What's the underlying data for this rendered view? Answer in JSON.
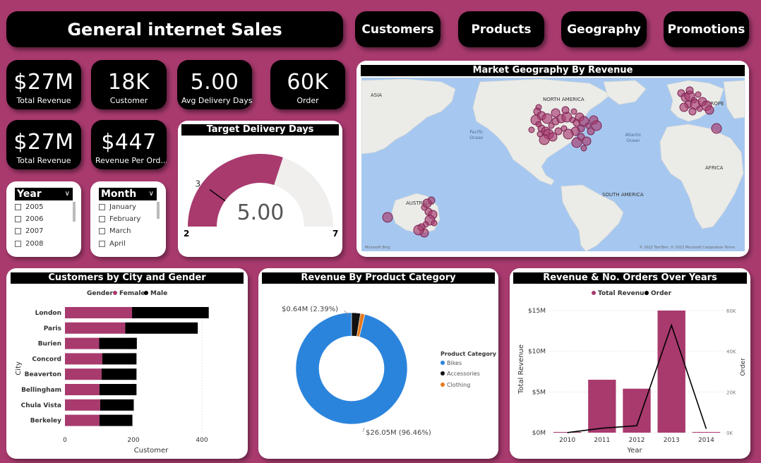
{
  "header": {
    "title": "General internet Sales",
    "nav": [
      "Customers",
      "Products",
      "Geography",
      "Promotions"
    ]
  },
  "kpis": [
    {
      "value": "$27M",
      "label": "Total Revenue"
    },
    {
      "value": "18K",
      "label": "Customer"
    },
    {
      "value": "5.00",
      "label": "Avg Delivery Days"
    },
    {
      "value": "60K",
      "label": "Order"
    },
    {
      "value": "$27M",
      "label": "Total Revenue"
    },
    {
      "value": "$447",
      "label": "Revenue Per Ord..."
    }
  ],
  "slicers": {
    "year": {
      "title": "Year",
      "options": [
        "2005",
        "2006",
        "2007",
        "2008"
      ]
    },
    "month": {
      "title": "Month",
      "options": [
        "January",
        "February",
        "March",
        "April"
      ]
    }
  },
  "gauge": {
    "title": "Target Delivery Days",
    "value": 5.0,
    "value_label": "5.00",
    "min": 2,
    "max": 7,
    "target": 3,
    "min_label": "2",
    "max_label": "7",
    "target_label": "3",
    "fill_color": "#A83A6E"
  },
  "map": {
    "title": "Market Geography By Revenue",
    "labels": {
      "asia": "ASIA",
      "north_america": "NORTH AMERICA",
      "europe": "EUROPE",
      "pacific": "Pacific\nOcean",
      "atlantic": "Atlantic\nOcean",
      "africa": "AFRICA",
      "south_america": "SOUTH AMERICA",
      "australia": "AUSTRALIA"
    },
    "bing": "Microsoft Bing",
    "copyright": "© 2022 TomTom, © 2022 Microsoft Corporation  Terms"
  },
  "colors": {
    "accent": "#A83A6E",
    "female": "#A83A6E",
    "male": "#000000",
    "bikes": "#2B84DC",
    "accessories": "#111111",
    "clothing": "#E67A1E"
  },
  "chart_data": [
    {
      "type": "bar",
      "title": "Customers by City and Gender",
      "legend_title": "Gender",
      "xlabel": "Customer",
      "ylabel": "City",
      "categories": [
        "London",
        "Paris",
        "Burien",
        "Concord",
        "Beaverton",
        "Bellingham",
        "Chula Vista",
        "Berkeley"
      ],
      "series": [
        {
          "name": "Female",
          "values": [
            196,
            176,
            100,
            109,
            107,
            101,
            103,
            101
          ]
        },
        {
          "name": "Male",
          "values": [
            224,
            212,
            110,
            100,
            102,
            108,
            98,
            96
          ]
        }
      ],
      "xticks": [
        "0",
        "200",
        "400"
      ],
      "xlim": [
        0,
        430
      ],
      "orientation": "horizontal",
      "stacked": true
    },
    {
      "type": "pie",
      "title": "Revenue By Product Category",
      "legend_title": "Product Category",
      "categories": [
        "Bikes",
        "Accessories",
        "Clothing"
      ],
      "values": [
        26.05,
        0.7,
        0.34
      ],
      "labels": [
        "$26.05M (96.46%)",
        "$0.64M (2.39%)"
      ],
      "donut": true
    },
    {
      "type": "bar",
      "title": "Revenue & No. Orders Over Years",
      "xlabel": "Year",
      "ylabel": "Total Revenue",
      "y2label": "Order",
      "categories": [
        "2010",
        "2011",
        "2012",
        "2013",
        "2014"
      ],
      "series": [
        {
          "name": "Total Revenue",
          "type": "bar",
          "values": [
            0.04,
            6.5,
            5.4,
            15.0,
            0.05
          ],
          "unit": "M"
        },
        {
          "name": "Order",
          "type": "line",
          "axis": "secondary",
          "values": [
            14,
            2200,
            3400,
            52800,
            1900
          ]
        }
      ],
      "yticks": [
        "$0M",
        "$5M",
        "$10M",
        "$15M"
      ],
      "ylim": [
        0,
        15
      ],
      "y2ticks": [
        "0K",
        "20K",
        "40K",
        "60K"
      ],
      "y2lim": [
        0,
        60000
      ]
    }
  ]
}
